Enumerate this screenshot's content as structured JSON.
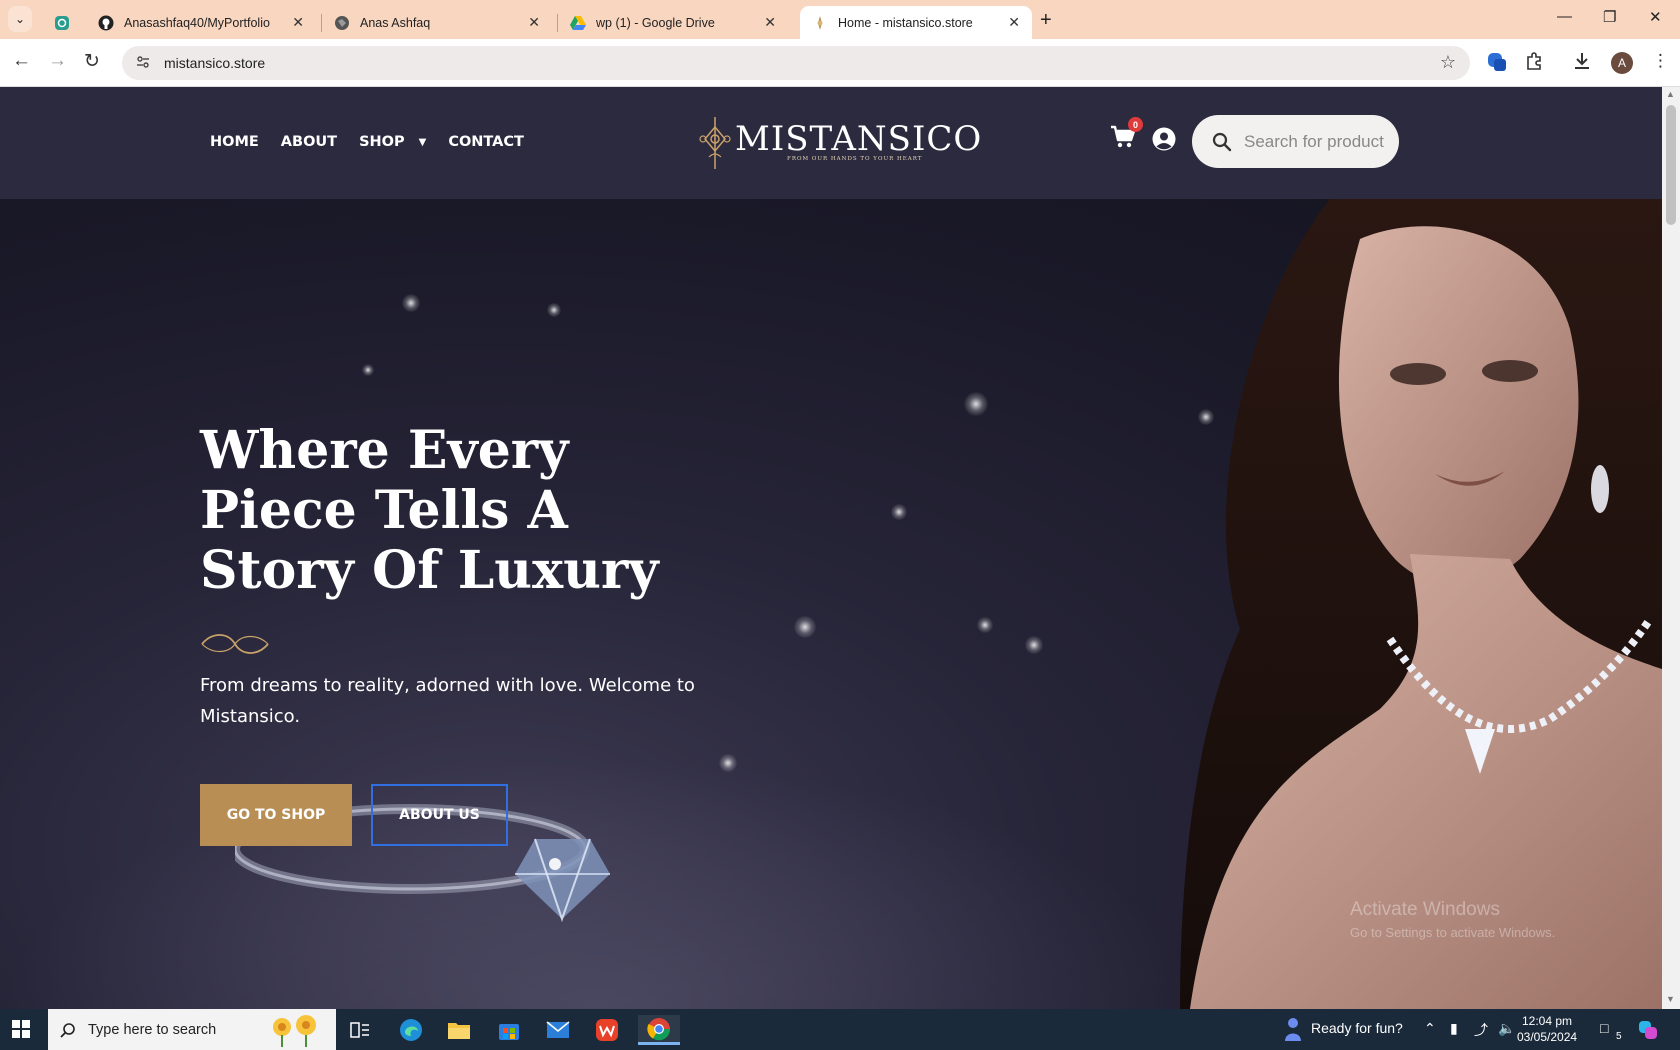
{
  "browser": {
    "tabs": [
      {
        "title": "",
        "icon": "chatgpt-icon"
      },
      {
        "title": "Anasashfaq40/MyPortfolio",
        "icon": "github-icon"
      },
      {
        "title": "Anas Ashfaq",
        "icon": "globe-icon"
      },
      {
        "title": "wp (1) - Google Drive",
        "icon": "google-drive-icon"
      },
      {
        "title": "Home - mistansico.store",
        "icon": "site-icon",
        "active": true
      }
    ],
    "url": "mistansico.store",
    "profile_initial": "A"
  },
  "site": {
    "nav": {
      "home": "HOME",
      "about": "ABOUT",
      "shop": "SHOP",
      "contact": "CONTACT"
    },
    "logo": {
      "wordmark": "MISTANSICO",
      "tagline": "FROM OUR HANDS TO YOUR HEART"
    },
    "cart_count": "0",
    "search_placeholder": "Search for products",
    "hero": {
      "title": "Where Every Piece Tells A Story Of Luxury",
      "subtitle": "From dreams to reality, adorned with love. Welcome to Mistansico.",
      "primary_button": "GO TO SHOP",
      "secondary_button": "ABOUT US"
    },
    "watermark": {
      "line1": "Activate Windows",
      "line2": "Go to Settings to activate Windows."
    },
    "colors": {
      "header_bg": "#2c2a3e",
      "accent_gold": "#b88e54",
      "outline_blue": "#2f6fe0",
      "cart_badge": "#e03b3b"
    }
  },
  "taskbar": {
    "search_placeholder": "Type here to search",
    "weather_text": "Ready for fun?",
    "time": "12:04 pm",
    "date": "03/05/2024",
    "notification_count": "5"
  }
}
